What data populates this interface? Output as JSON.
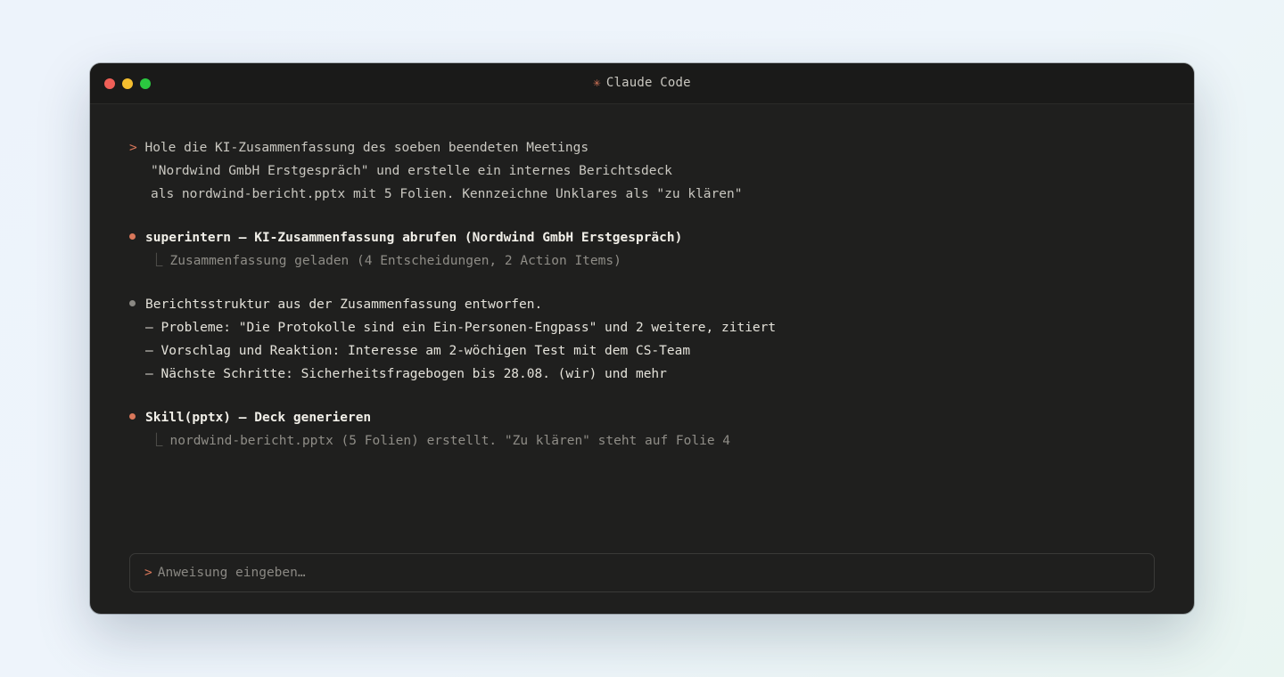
{
  "window": {
    "title": "Claude Code",
    "title_icon": "asterisk-icon"
  },
  "transcript": {
    "user_prompt": {
      "marker": ">",
      "lines": [
        "Hole die KI-Zusammenfassung des soeben beendeten Meetings",
        "\"Nordwind GmbH Erstgespräch\" und erstelle ein internes Berichtsdeck",
        "als nordwind-bericht.pptx mit 5 Folien. Kennzeichne Unklares als \"zu klären\""
      ]
    },
    "tool_call_1": {
      "title": "superintern – KI-Zusammenfassung abrufen (Nordwind GmbH Erstgespräch)",
      "result": "Zusammenfassung geladen (4 Entscheidungen, 2 Action Items)"
    },
    "assistant_message": {
      "text": "Berichtsstruktur aus der Zusammenfassung entworfen.",
      "items": [
        "– Probleme: \"Die Protokolle sind ein Ein-Personen-Engpass\" und 2 weitere, zitiert",
        "– Vorschlag und Reaktion: Interesse am 2-wöchigen Test mit dem CS-Team",
        "– Nächste Schritte: Sicherheitsfragebogen bis 28.08. (wir) und mehr"
      ]
    },
    "tool_call_2": {
      "title": "Skill(pptx) – Deck generieren",
      "result": "nordwind-bericht.pptx (5 Folien) erstellt. \"Zu klären\" steht auf Folie 4"
    }
  },
  "input": {
    "marker": ">",
    "placeholder": "Anweisung eingeben…"
  },
  "colors": {
    "accent": "#d9775a",
    "window_bg": "#1f1f1e",
    "muted_text": "#8f8d87"
  }
}
